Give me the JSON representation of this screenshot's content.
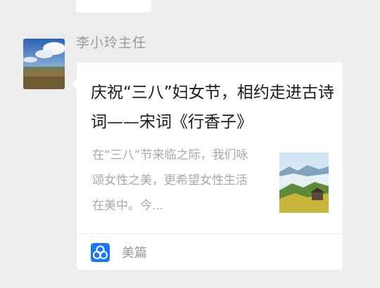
{
  "message": {
    "sender_name": "李小玲主任",
    "card": {
      "title": "庆祝“三八”妇女节，相约走进古诗词——宋词《行香子》",
      "description": "在“三八”节来临之际，我们咏颂女性之美，更希望女性生活在美中。今...",
      "source_name": "美篇",
      "source_icon": "meipian-logo-icon",
      "source_color": "#1a78f0"
    }
  }
}
